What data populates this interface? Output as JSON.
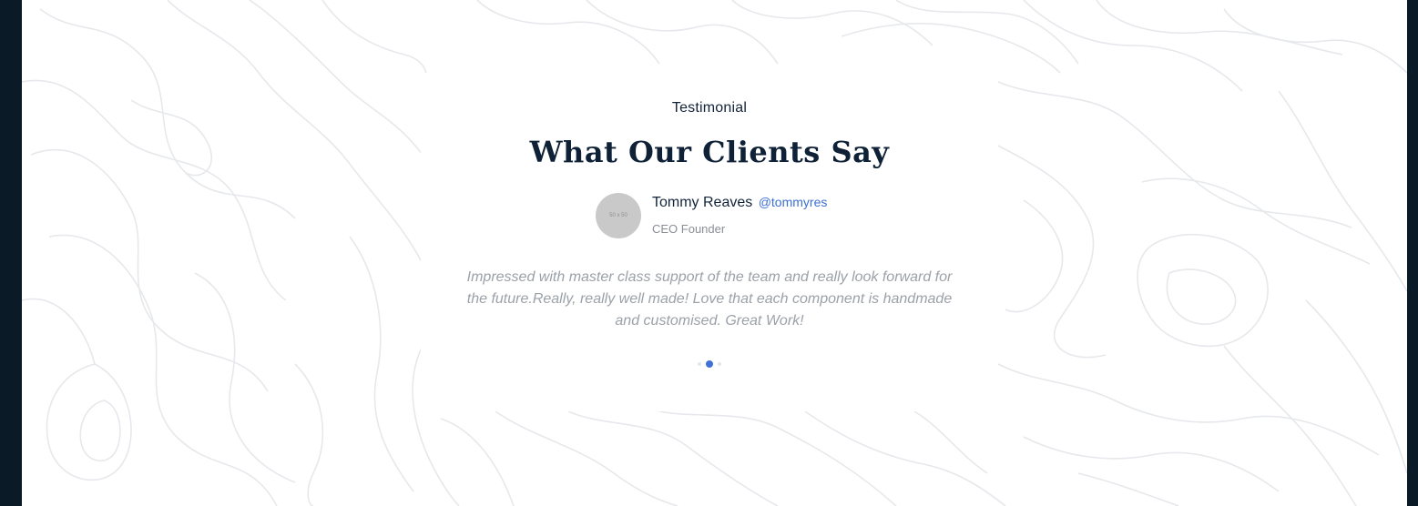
{
  "testimonial": {
    "eyebrow": "Testimonial",
    "heading": "What Our Clients Say",
    "author": {
      "name": "Tommy Reaves",
      "handle": "@tommyres",
      "role": "CEO Founder",
      "avatar_placeholder": "50 x 50"
    },
    "quote": "Impressed with master class support of the team and really look forward for the future.Really, really well made! Love that each component is handmade and customised. Great Work!",
    "carousel": {
      "slide_count": 3,
      "active_index": 1
    }
  },
  "colors": {
    "page_background": "#0b1a27",
    "panel": "#ffffff",
    "heading": "#0f2136",
    "handle_link": "#3d6fd1",
    "quote_text": "#9ba1a8",
    "contour_lines": "#e6e8eb",
    "active_dot": "#3f72d9"
  }
}
